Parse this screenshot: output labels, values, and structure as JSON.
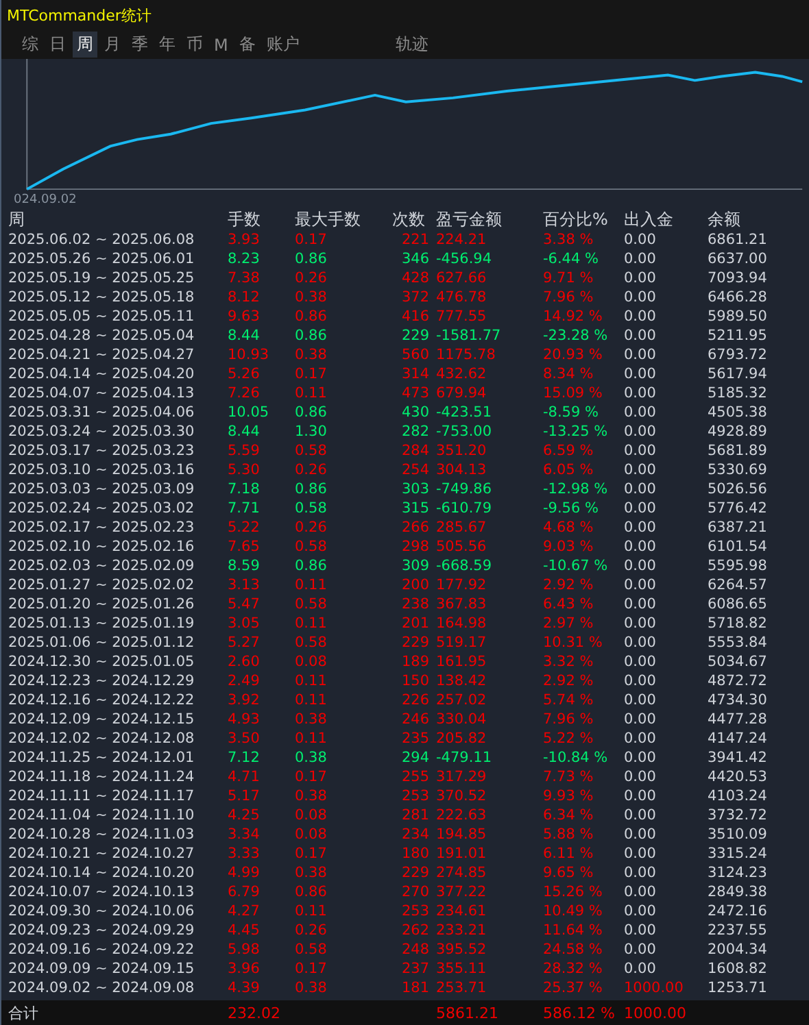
{
  "window": {
    "title": "MTCommander统计"
  },
  "tabs": [
    {
      "label": "综",
      "selected": false
    },
    {
      "label": "日",
      "selected": false
    },
    {
      "label": "周",
      "selected": true
    },
    {
      "label": "月",
      "selected": false
    },
    {
      "label": "季",
      "selected": false
    },
    {
      "label": "年",
      "selected": false
    },
    {
      "label": "币",
      "selected": false
    },
    {
      "label": "M",
      "selected": false
    },
    {
      "label": "备",
      "selected": false
    },
    {
      "label": "账户",
      "selected": false
    }
  ],
  "trail_tab": {
    "label": "轨迹",
    "selected": false
  },
  "chart": {
    "start_label": "024.09.02"
  },
  "table": {
    "columns": [
      "周",
      "手数",
      "最大手数",
      "次数",
      "盈亏金额",
      "百分比%",
      "出入金",
      "余额"
    ],
    "rows": [
      {
        "week": "2025.06.02 ~ 2025.06.08",
        "lots": "3.93",
        "max_lots": "0.17",
        "count": "221",
        "pnl": "224.21",
        "pct": "3.38 %",
        "flow": "0.00",
        "balance": "6861.21",
        "loss": false,
        "deposit": false
      },
      {
        "week": "2025.05.26 ~ 2025.06.01",
        "lots": "8.23",
        "max_lots": "0.86",
        "count": "346",
        "pnl": "-456.94",
        "pct": "-6.44 %",
        "flow": "0.00",
        "balance": "6637.00",
        "loss": true,
        "deposit": false
      },
      {
        "week": "2025.05.19 ~ 2025.05.25",
        "lots": "7.38",
        "max_lots": "0.26",
        "count": "428",
        "pnl": "627.66",
        "pct": "9.71 %",
        "flow": "0.00",
        "balance": "7093.94",
        "loss": false,
        "deposit": false
      },
      {
        "week": "2025.05.12 ~ 2025.05.18",
        "lots": "8.12",
        "max_lots": "0.38",
        "count": "372",
        "pnl": "476.78",
        "pct": "7.96 %",
        "flow": "0.00",
        "balance": "6466.28",
        "loss": false,
        "deposit": false
      },
      {
        "week": "2025.05.05 ~ 2025.05.11",
        "lots": "9.63",
        "max_lots": "0.86",
        "count": "416",
        "pnl": "777.55",
        "pct": "14.92 %",
        "flow": "0.00",
        "balance": "5989.50",
        "loss": false,
        "deposit": false
      },
      {
        "week": "2025.04.28 ~ 2025.05.04",
        "lots": "8.44",
        "max_lots": "0.86",
        "count": "229",
        "pnl": "-1581.77",
        "pct": "-23.28 %",
        "flow": "0.00",
        "balance": "5211.95",
        "loss": true,
        "deposit": false
      },
      {
        "week": "2025.04.21 ~ 2025.04.27",
        "lots": "10.93",
        "max_lots": "0.38",
        "count": "560",
        "pnl": "1175.78",
        "pct": "20.93 %",
        "flow": "0.00",
        "balance": "6793.72",
        "loss": false,
        "deposit": false
      },
      {
        "week": "2025.04.14 ~ 2025.04.20",
        "lots": "5.26",
        "max_lots": "0.17",
        "count": "314",
        "pnl": "432.62",
        "pct": "8.34 %",
        "flow": "0.00",
        "balance": "5617.94",
        "loss": false,
        "deposit": false
      },
      {
        "week": "2025.04.07 ~ 2025.04.13",
        "lots": "7.26",
        "max_lots": "0.11",
        "count": "473",
        "pnl": "679.94",
        "pct": "15.09 %",
        "flow": "0.00",
        "balance": "5185.32",
        "loss": false,
        "deposit": false
      },
      {
        "week": "2025.03.31 ~ 2025.04.06",
        "lots": "10.05",
        "max_lots": "0.86",
        "count": "430",
        "pnl": "-423.51",
        "pct": "-8.59 %",
        "flow": "0.00",
        "balance": "4505.38",
        "loss": true,
        "deposit": false
      },
      {
        "week": "2025.03.24 ~ 2025.03.30",
        "lots": "8.44",
        "max_lots": "1.30",
        "count": "282",
        "pnl": "-753.00",
        "pct": "-13.25 %",
        "flow": "0.00",
        "balance": "4928.89",
        "loss": true,
        "deposit": false
      },
      {
        "week": "2025.03.17 ~ 2025.03.23",
        "lots": "5.59",
        "max_lots": "0.58",
        "count": "284",
        "pnl": "351.20",
        "pct": "6.59 %",
        "flow": "0.00",
        "balance": "5681.89",
        "loss": false,
        "deposit": false
      },
      {
        "week": "2025.03.10 ~ 2025.03.16",
        "lots": "5.30",
        "max_lots": "0.26",
        "count": "254",
        "pnl": "304.13",
        "pct": "6.05 %",
        "flow": "0.00",
        "balance": "5330.69",
        "loss": false,
        "deposit": false
      },
      {
        "week": "2025.03.03 ~ 2025.03.09",
        "lots": "7.18",
        "max_lots": "0.86",
        "count": "303",
        "pnl": "-749.86",
        "pct": "-12.98 %",
        "flow": "0.00",
        "balance": "5026.56",
        "loss": true,
        "deposit": false
      },
      {
        "week": "2025.02.24 ~ 2025.03.02",
        "lots": "7.71",
        "max_lots": "0.58",
        "count": "315",
        "pnl": "-610.79",
        "pct": "-9.56 %",
        "flow": "0.00",
        "balance": "5776.42",
        "loss": true,
        "deposit": false
      },
      {
        "week": "2025.02.17 ~ 2025.02.23",
        "lots": "5.22",
        "max_lots": "0.26",
        "count": "266",
        "pnl": "285.67",
        "pct": "4.68 %",
        "flow": "0.00",
        "balance": "6387.21",
        "loss": false,
        "deposit": false
      },
      {
        "week": "2025.02.10 ~ 2025.02.16",
        "lots": "7.65",
        "max_lots": "0.58",
        "count": "298",
        "pnl": "505.56",
        "pct": "9.03 %",
        "flow": "0.00",
        "balance": "6101.54",
        "loss": false,
        "deposit": false
      },
      {
        "week": "2025.02.03 ~ 2025.02.09",
        "lots": "8.59",
        "max_lots": "0.86",
        "count": "309",
        "pnl": "-668.59",
        "pct": "-10.67 %",
        "flow": "0.00",
        "balance": "5595.98",
        "loss": true,
        "deposit": false
      },
      {
        "week": "2025.01.27 ~ 2025.02.02",
        "lots": "3.13",
        "max_lots": "0.11",
        "count": "200",
        "pnl": "177.92",
        "pct": "2.92 %",
        "flow": "0.00",
        "balance": "6264.57",
        "loss": false,
        "deposit": false
      },
      {
        "week": "2025.01.20 ~ 2025.01.26",
        "lots": "5.47",
        "max_lots": "0.58",
        "count": "238",
        "pnl": "367.83",
        "pct": "6.43 %",
        "flow": "0.00",
        "balance": "6086.65",
        "loss": false,
        "deposit": false
      },
      {
        "week": "2025.01.13 ~ 2025.01.19",
        "lots": "3.05",
        "max_lots": "0.11",
        "count": "201",
        "pnl": "164.98",
        "pct": "2.97 %",
        "flow": "0.00",
        "balance": "5718.82",
        "loss": false,
        "deposit": false
      },
      {
        "week": "2025.01.06 ~ 2025.01.12",
        "lots": "5.27",
        "max_lots": "0.58",
        "count": "229",
        "pnl": "519.17",
        "pct": "10.31 %",
        "flow": "0.00",
        "balance": "5553.84",
        "loss": false,
        "deposit": false
      },
      {
        "week": "2024.12.30 ~ 2025.01.05",
        "lots": "2.60",
        "max_lots": "0.08",
        "count": "189",
        "pnl": "161.95",
        "pct": "3.32 %",
        "flow": "0.00",
        "balance": "5034.67",
        "loss": false,
        "deposit": false
      },
      {
        "week": "2024.12.23 ~ 2024.12.29",
        "lots": "2.49",
        "max_lots": "0.11",
        "count": "150",
        "pnl": "138.42",
        "pct": "2.92 %",
        "flow": "0.00",
        "balance": "4872.72",
        "loss": false,
        "deposit": false
      },
      {
        "week": "2024.12.16 ~ 2024.12.22",
        "lots": "3.92",
        "max_lots": "0.11",
        "count": "226",
        "pnl": "257.02",
        "pct": "5.74 %",
        "flow": "0.00",
        "balance": "4734.30",
        "loss": false,
        "deposit": false
      },
      {
        "week": "2024.12.09 ~ 2024.12.15",
        "lots": "4.93",
        "max_lots": "0.38",
        "count": "246",
        "pnl": "330.04",
        "pct": "7.96 %",
        "flow": "0.00",
        "balance": "4477.28",
        "loss": false,
        "deposit": false
      },
      {
        "week": "2024.12.02 ~ 2024.12.08",
        "lots": "3.50",
        "max_lots": "0.11",
        "count": "235",
        "pnl": "205.82",
        "pct": "5.22 %",
        "flow": "0.00",
        "balance": "4147.24",
        "loss": false,
        "deposit": false
      },
      {
        "week": "2024.11.25 ~ 2024.12.01",
        "lots": "7.12",
        "max_lots": "0.38",
        "count": "294",
        "pnl": "-479.11",
        "pct": "-10.84 %",
        "flow": "0.00",
        "balance": "3941.42",
        "loss": true,
        "deposit": false
      },
      {
        "week": "2024.11.18 ~ 2024.11.24",
        "lots": "4.71",
        "max_lots": "0.17",
        "count": "255",
        "pnl": "317.29",
        "pct": "7.73 %",
        "flow": "0.00",
        "balance": "4420.53",
        "loss": false,
        "deposit": false
      },
      {
        "week": "2024.11.11 ~ 2024.11.17",
        "lots": "5.17",
        "max_lots": "0.38",
        "count": "253",
        "pnl": "370.52",
        "pct": "9.93 %",
        "flow": "0.00",
        "balance": "4103.24",
        "loss": false,
        "deposit": false
      },
      {
        "week": "2024.11.04 ~ 2024.11.10",
        "lots": "4.25",
        "max_lots": "0.08",
        "count": "281",
        "pnl": "222.63",
        "pct": "6.34 %",
        "flow": "0.00",
        "balance": "3732.72",
        "loss": false,
        "deposit": false
      },
      {
        "week": "2024.10.28 ~ 2024.11.03",
        "lots": "3.34",
        "max_lots": "0.08",
        "count": "234",
        "pnl": "194.85",
        "pct": "5.88 %",
        "flow": "0.00",
        "balance": "3510.09",
        "loss": false,
        "deposit": false
      },
      {
        "week": "2024.10.21 ~ 2024.10.27",
        "lots": "3.33",
        "max_lots": "0.17",
        "count": "180",
        "pnl": "191.01",
        "pct": "6.11 %",
        "flow": "0.00",
        "balance": "3315.24",
        "loss": false,
        "deposit": false
      },
      {
        "week": "2024.10.14 ~ 2024.10.20",
        "lots": "4.99",
        "max_lots": "0.38",
        "count": "229",
        "pnl": "274.85",
        "pct": "9.65 %",
        "flow": "0.00",
        "balance": "3124.23",
        "loss": false,
        "deposit": false
      },
      {
        "week": "2024.10.07 ~ 2024.10.13",
        "lots": "6.79",
        "max_lots": "0.86",
        "count": "270",
        "pnl": "377.22",
        "pct": "15.26 %",
        "flow": "0.00",
        "balance": "2849.38",
        "loss": false,
        "deposit": false
      },
      {
        "week": "2024.09.30 ~ 2024.10.06",
        "lots": "4.27",
        "max_lots": "0.11",
        "count": "253",
        "pnl": "234.61",
        "pct": "10.49 %",
        "flow": "0.00",
        "balance": "2472.16",
        "loss": false,
        "deposit": false
      },
      {
        "week": "2024.09.23 ~ 2024.09.29",
        "lots": "4.45",
        "max_lots": "0.26",
        "count": "262",
        "pnl": "233.21",
        "pct": "11.64 %",
        "flow": "0.00",
        "balance": "2237.55",
        "loss": false,
        "deposit": false
      },
      {
        "week": "2024.09.16 ~ 2024.09.22",
        "lots": "5.98",
        "max_lots": "0.58",
        "count": "248",
        "pnl": "395.52",
        "pct": "24.58 %",
        "flow": "0.00",
        "balance": "2004.34",
        "loss": false,
        "deposit": false
      },
      {
        "week": "2024.09.09 ~ 2024.09.15",
        "lots": "3.96",
        "max_lots": "0.17",
        "count": "237",
        "pnl": "355.11",
        "pct": "28.32 %",
        "flow": "0.00",
        "balance": "1608.82",
        "loss": false,
        "deposit": false
      },
      {
        "week": "2024.09.02 ~ 2024.09.08",
        "lots": "4.39",
        "max_lots": "0.38",
        "count": "181",
        "pnl": "253.71",
        "pct": "25.37 %",
        "flow": "1000.00",
        "balance": "1253.71",
        "loss": false,
        "deposit": true
      }
    ],
    "total": {
      "label": "合计",
      "lots": "232.02",
      "pnl": "5861.21",
      "pct": "586.12 %",
      "flow": "1000.00"
    }
  }
}
